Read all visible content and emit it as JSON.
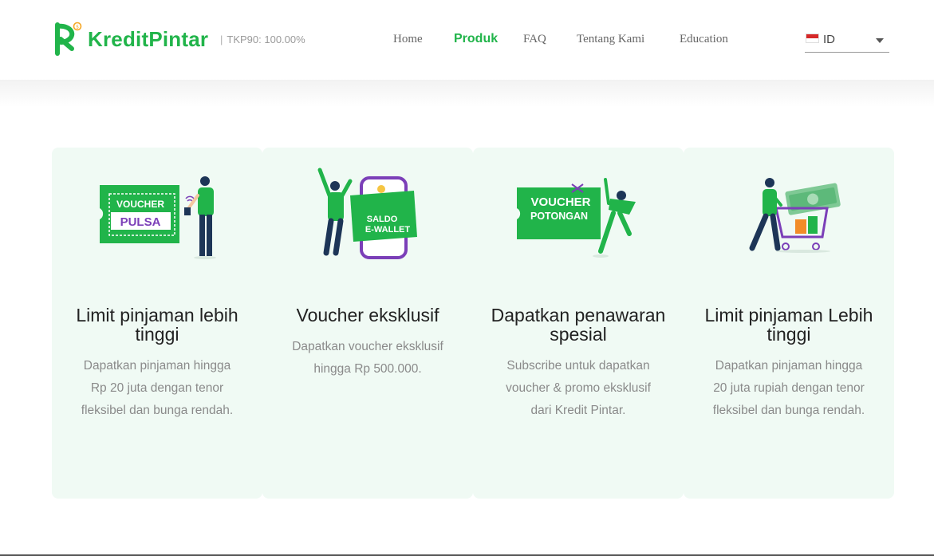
{
  "header": {
    "logo_text": "KreditPintar",
    "tkp_text": "TKP90: 100.00%",
    "tkp_separator": "|",
    "nav": [
      {
        "label": "Home",
        "active": false
      },
      {
        "label": "Produk",
        "active": true
      },
      {
        "label": "FAQ",
        "active": false
      },
      {
        "label": "Tentang Kami",
        "active": false
      },
      {
        "label": "Education",
        "active": false
      }
    ],
    "language": {
      "selected": "ID",
      "flag": "indonesia-flag"
    },
    "brand_color": "#21b44a"
  },
  "cards": [
    {
      "illustration": {
        "line1": "VOUCHER",
        "line2": "PULSA"
      },
      "title": "Limit pinjaman lebih tinggi",
      "description": "Dapatkan pinjaman hingga Rp 20 juta dengan tenor fleksibel dan bunga rendah."
    },
    {
      "illustration": {
        "line1": "SALDO",
        "line2": "E-WALLET"
      },
      "title": "Voucher eksklusif",
      "description": "Dapatkan voucher eksklusif hingga Rp 500.000."
    },
    {
      "illustration": {
        "line1": "VOUCHER",
        "line2": "POTONGAN"
      },
      "title": "Dapatkan penawaran spesial",
      "description": "Subscribe untuk dapatkan voucher & promo eksklusif dari Kredit Pintar."
    },
    {
      "illustration": {
        "line1": "",
        "line2": ""
      },
      "title": "Limit pinjaman Lebih tinggi",
      "description": "Dapatkan pinjaman hingga 20 juta rupiah dengan tenor fleksibel dan bunga rendah."
    }
  ],
  "colors": {
    "card_bg": "#f0faf4",
    "green": "#21b44a",
    "purple": "#7b3fb8"
  }
}
